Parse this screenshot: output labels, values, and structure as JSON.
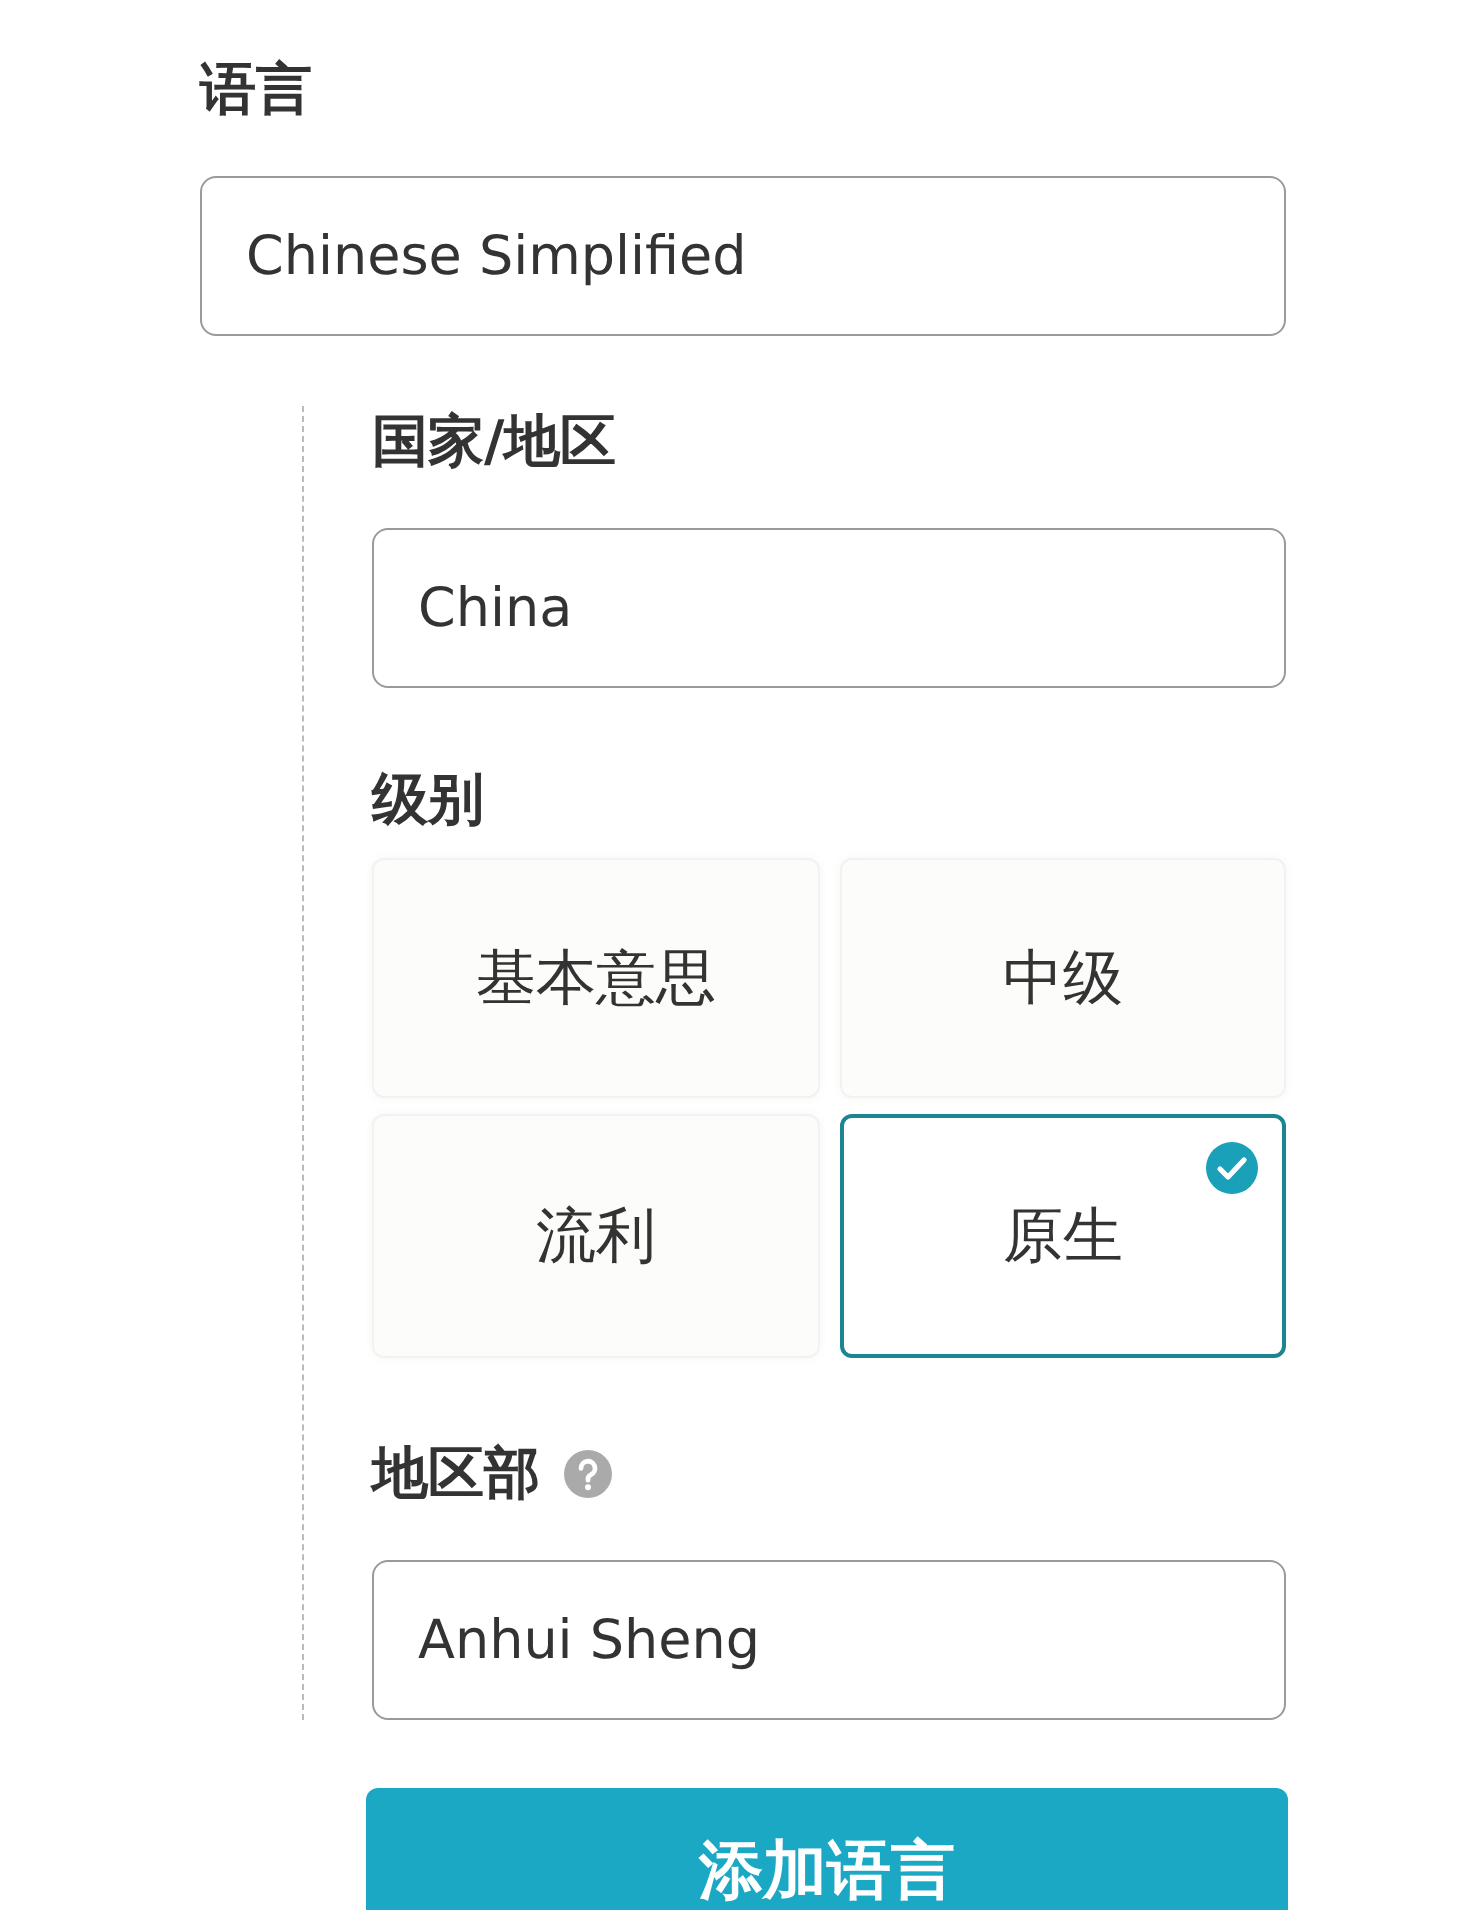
{
  "language": {
    "label": "语言",
    "value": "Chinese Simplified"
  },
  "details": {
    "country": {
      "label": "国家/地区",
      "value": "China"
    },
    "level": {
      "label": "级别",
      "options": [
        {
          "label": "基本意思",
          "selected": false
        },
        {
          "label": "中级",
          "selected": false
        },
        {
          "label": "流利",
          "selected": false
        },
        {
          "label": "原生",
          "selected": true
        }
      ]
    },
    "region": {
      "label": "地区部",
      "value": "Anhui Sheng"
    }
  },
  "add_button": "添加语言"
}
